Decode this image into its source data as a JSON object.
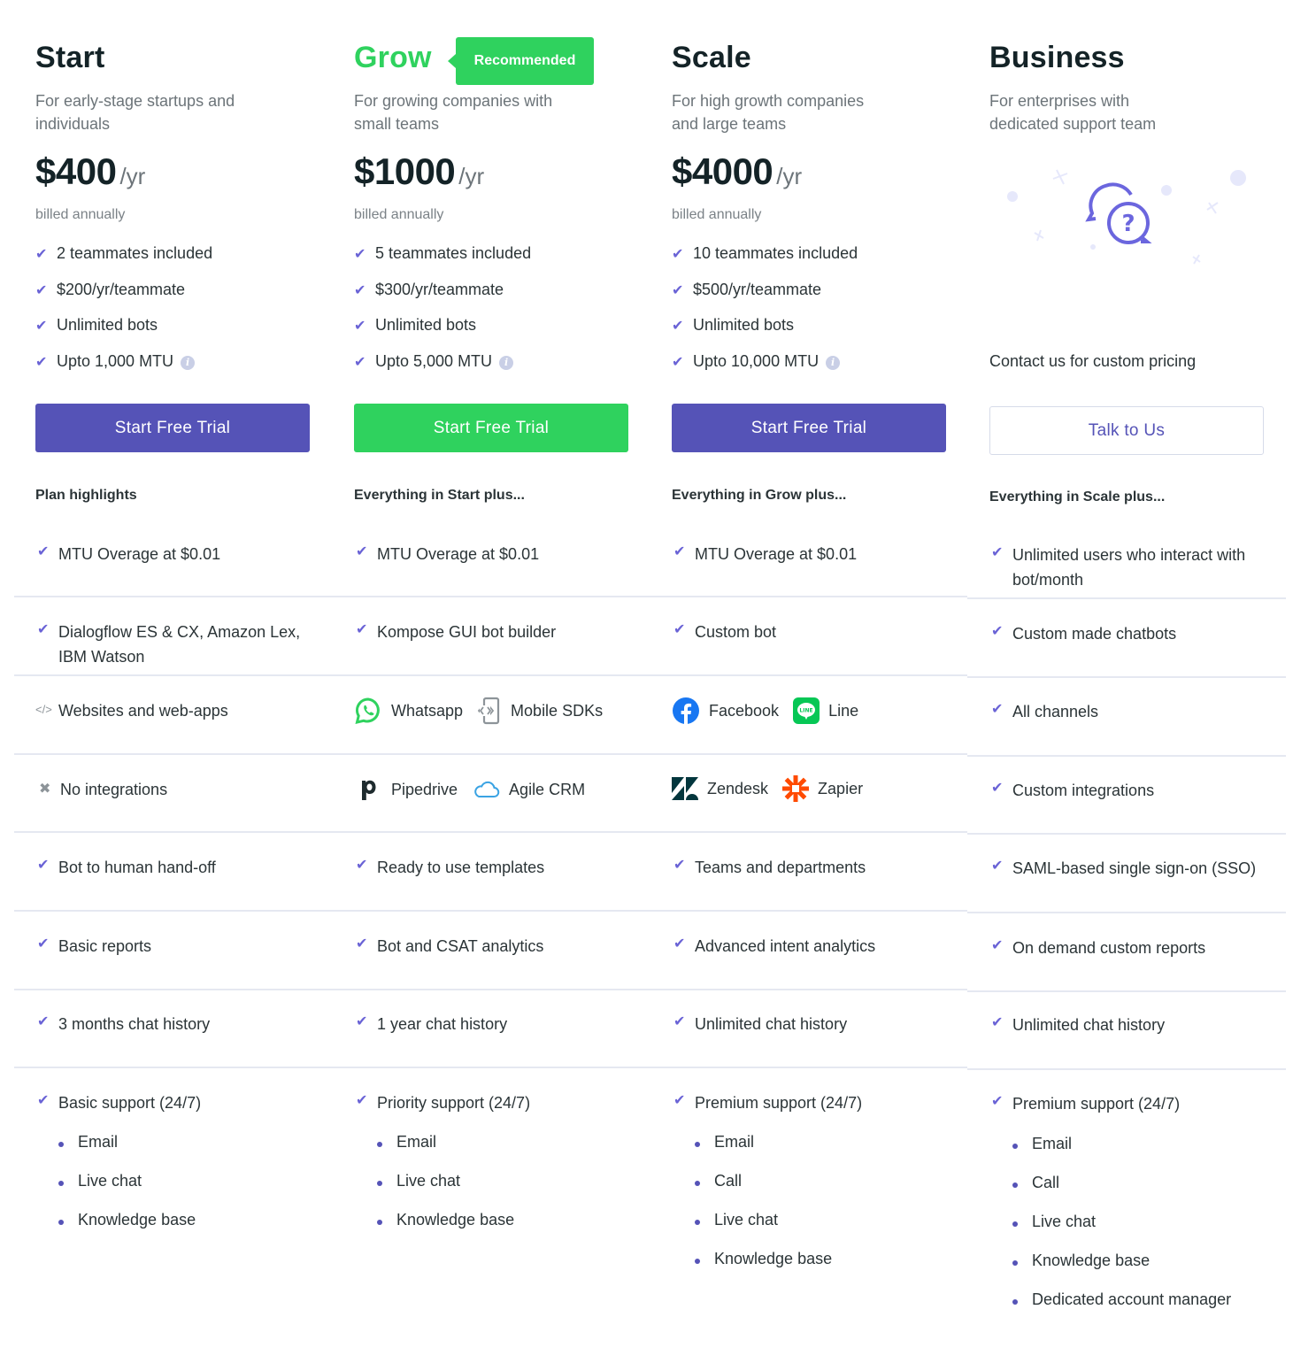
{
  "colors": {
    "primary": "#5553b7",
    "accent_green": "#2fd25e",
    "check": "#6a63d6",
    "text_dark": "#142327",
    "text_muted": "#6c7479",
    "divider": "#e5e8f1"
  },
  "plans": [
    {
      "name": "Start",
      "description": "For early-stage startups and individuals",
      "price": "$400",
      "period": "/yr",
      "billing": "billed annually",
      "included": [
        "2 teammates included",
        "$200/yr/teammate",
        "Unlimited bots",
        "Upto 1,000 MTU"
      ],
      "cta": "Start Free Trial",
      "highlights_heading": "Plan highlights",
      "features": {
        "mtu_overage": "MTU Overage at $0.01",
        "bots": "Dialogflow ES & CX, Amazon Lex, IBM Watson",
        "channels": [
          {
            "icon": "code-icon",
            "label": "Websites and web-apps"
          }
        ],
        "integrations_none": "No integrations",
        "handoff": "Bot to human hand-off",
        "reports": "Basic reports",
        "history": "3 months chat history",
        "support": "Basic support (24/7)",
        "support_items": [
          "Email",
          "Live chat",
          "Knowledge base"
        ]
      }
    },
    {
      "name": "Grow",
      "badge": "Recommended",
      "description": "For growing companies with small teams",
      "price": "$1000",
      "period": "/yr",
      "billing": "billed annually",
      "included": [
        "5 teammates included",
        "$300/yr/teammate",
        "Unlimited bots",
        "Upto 5,000 MTU"
      ],
      "cta": "Start Free Trial",
      "highlights_heading": "Everything in Start plus...",
      "features": {
        "mtu_overage": "MTU Overage at $0.01",
        "bots": "Kompose GUI bot builder",
        "channels": [
          {
            "icon": "whatsapp-icon",
            "label": "Whatsapp"
          },
          {
            "icon": "mobile-sdk-icon",
            "label": "Mobile SDKs"
          }
        ],
        "integrations": [
          {
            "icon": "pipedrive-icon",
            "label": "Pipedrive"
          },
          {
            "icon": "agile-crm-icon",
            "label": "Agile CRM"
          }
        ],
        "handoff": "Ready to use templates",
        "reports": "Bot and CSAT analytics",
        "history": "1 year chat history",
        "support": "Priority support (24/7)",
        "support_items": [
          "Email",
          "Live chat",
          "Knowledge base"
        ]
      }
    },
    {
      "name": "Scale",
      "description": "For high growth companies and large teams",
      "price": "$4000",
      "period": "/yr",
      "billing": "billed annually",
      "included": [
        "10 teammates included",
        "$500/yr/teammate",
        "Unlimited bots",
        "Upto 10,000 MTU"
      ],
      "cta": "Start Free Trial",
      "highlights_heading": "Everything in Grow plus...",
      "features": {
        "mtu_overage": "MTU Overage at $0.01",
        "bots": "Custom bot",
        "channels": [
          {
            "icon": "facebook-icon",
            "label": "Facebook"
          },
          {
            "icon": "line-icon",
            "label": "Line"
          }
        ],
        "integrations": [
          {
            "icon": "zendesk-icon",
            "label": "Zendesk"
          },
          {
            "icon": "zapier-icon",
            "label": "Zapier"
          }
        ],
        "handoff": "Teams and departments",
        "reports": "Advanced intent analytics",
        "history": "Unlimited chat history",
        "support": "Premium support (24/7)",
        "support_items": [
          "Email",
          "Call",
          "Live chat",
          "Knowledge base"
        ]
      }
    },
    {
      "name": "Business",
      "description": "For enterprises with dedicated support team",
      "contact_text": "Contact us for custom pricing",
      "cta": "Talk to Us",
      "highlights_heading": "Everything in Scale plus...",
      "features": {
        "mtu_overage": "Unlimited users who interact with bot/month",
        "bots": "Custom made chatbots",
        "channels_text": "All channels",
        "integrations_text": "Custom integrations",
        "handoff": "SAML-based single sign-on (SSO)",
        "reports": "On demand custom reports",
        "history": "Unlimited chat history",
        "support": "Premium support (24/7)",
        "support_items": [
          "Email",
          "Call",
          "Live chat",
          "Knowledge base",
          "Dedicated account manager"
        ]
      }
    }
  ]
}
